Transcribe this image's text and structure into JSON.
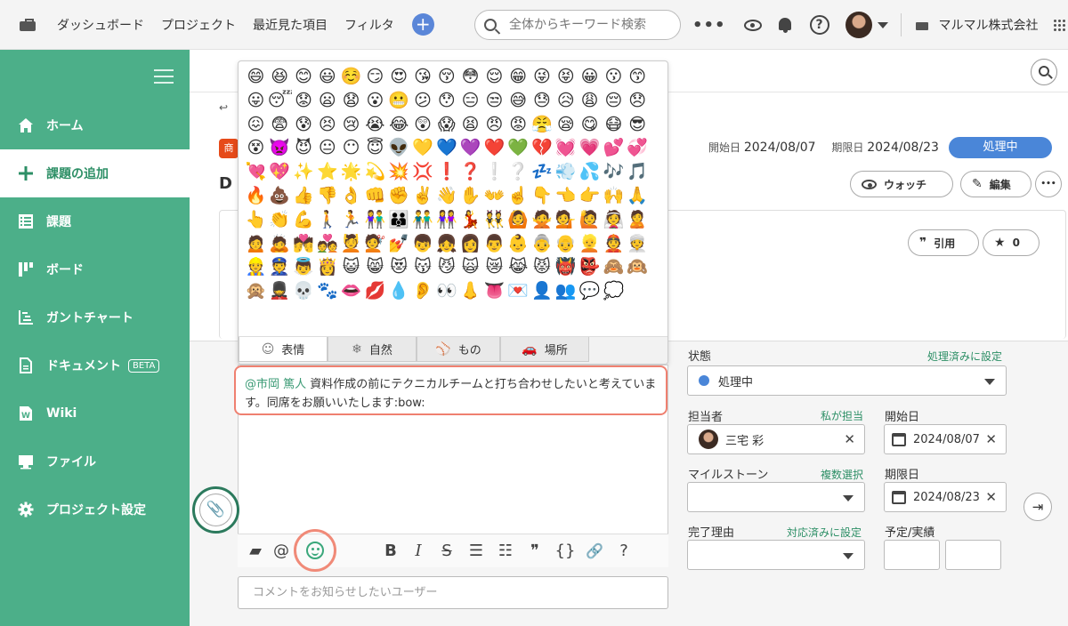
{
  "topbar": {
    "nav": [
      "ダッシュボード",
      "プロジェクト",
      "最近見た項目",
      "フィルタ"
    ],
    "add_label": "+",
    "search_placeholder": "全体からキーワード検索",
    "more_label": "•••",
    "help_label": "?",
    "company": "マルマル株式会社"
  },
  "sidebar": {
    "items": [
      {
        "label": "ホーム",
        "icon": "home-icon"
      },
      {
        "label": "課題の追加",
        "icon": "plus-icon",
        "active": true
      },
      {
        "label": "課題",
        "icon": "list-icon"
      },
      {
        "label": "ボード",
        "icon": "board-icon"
      },
      {
        "label": "ガントチャート",
        "icon": "gantt-icon"
      },
      {
        "label": "ドキュメント",
        "icon": "document-icon",
        "badge": "BETA"
      },
      {
        "label": "Wiki",
        "icon": "wiki-icon"
      },
      {
        "label": "ファイル",
        "icon": "file-icon"
      },
      {
        "label": "プロジェクト設定",
        "icon": "gear-icon"
      }
    ]
  },
  "issue": {
    "title_prefix": "D",
    "tag_char": "商",
    "back_char": "↩",
    "start_label": "開始日",
    "start_date": "2024/08/07",
    "due_label": "期限日",
    "due_date": "2024/08/23",
    "status": "処理中",
    "watch_label": "ウォッチ",
    "edit_label": "編集",
    "more_label": "•••",
    "quote_label": "引用",
    "star_count": "0"
  },
  "emoji_picker": {
    "emojis": [
      "😄",
      "😆",
      "😊",
      "😃",
      "☺️",
      "😏",
      "😍",
      "😘",
      "😚",
      "😳",
      "😌",
      "😁",
      "😜",
      "😝",
      "😀",
      "😗",
      "😙",
      "😛",
      "😴",
      "😟",
      "😦",
      "😧",
      "😮",
      "😬",
      "😕",
      "😯",
      "😑",
      "😒",
      "😅",
      "😓",
      "😥",
      "😩",
      "😔",
      "😞",
      "😖",
      "😨",
      "😰",
      "😣",
      "😢",
      "😭",
      "😂",
      "😲",
      "😱",
      "😫",
      "😠",
      "😡",
      "😤",
      "😪",
      "😋",
      "😷",
      "😎",
      "😵",
      "👿",
      "😈",
      "😐",
      "😶",
      "😇",
      "👽",
      "💛",
      "💙",
      "💜",
      "❤️",
      "💚",
      "💔",
      "💓",
      "💗",
      "💕",
      "💞",
      "💘",
      "💖",
      "✨",
      "⭐",
      "🌟",
      "💫",
      "💥",
      "💢",
      "❗",
      "❓",
      "❕",
      "❔",
      "💤",
      "💨",
      "💦",
      "🎶",
      "🎵",
      "🔥",
      "💩",
      "👍",
      "👎",
      "👌",
      "👊",
      "✊",
      "✌️",
      "👋",
      "✋",
      "👐",
      "☝️",
      "👇",
      "👈",
      "👉",
      "🙌",
      "🙏",
      "👆",
      "👏",
      "💪",
      "🚶",
      "🏃",
      "👫",
      "👪",
      "👬",
      "👭",
      "💃",
      "👯",
      "🙆",
      "🙅",
      "💁",
      "🙋",
      "👰",
      "🙎",
      "🙍",
      "🙇",
      "💏",
      "💑",
      "💆",
      "💇",
      "💅",
      "👦",
      "👧",
      "👩",
      "👨",
      "👶",
      "👵",
      "👴",
      "👱",
      "👲",
      "👳",
      "👷",
      "👮",
      "👼",
      "👸",
      "😺",
      "😸",
      "😻",
      "😽",
      "😼",
      "🙀",
      "😿",
      "😹",
      "😾",
      "👹",
      "👺",
      "🙈",
      "🙉",
      "🙊",
      "💂",
      "💀",
      "🐾",
      "👄",
      "💋",
      "💧",
      "👂",
      "👀",
      "👃",
      "👅",
      "💌",
      "👤",
      "👥",
      "💬",
      "💭"
    ],
    "tabs": [
      {
        "label": "表情",
        "glyph": "☺",
        "icon": "smile-icon"
      },
      {
        "label": "自然",
        "glyph": "❄",
        "icon": "snowflake-icon"
      },
      {
        "label": "もの",
        "glyph": "⚾",
        "icon": "ball-icon"
      },
      {
        "label": "場所",
        "glyph": "🚗",
        "icon": "car-icon"
      }
    ]
  },
  "comment": {
    "mention": "@市岡 篤人",
    "text": " 資料作成の前にテクニカルチームと打ち合わせしたいと考えています。同席をお願いいたします:bow:",
    "notify_placeholder": "コメントをお知らせしたいユーザー"
  },
  "toolbar": {
    "mention_label": "@",
    "bold": "B",
    "italic": "I",
    "strike": "S",
    "bullet": "☰",
    "numbered": "☷",
    "quote": "❞",
    "code": "{}",
    "link": "🔗",
    "help": "?"
  },
  "form": {
    "status_label": "状態",
    "status_link": "処理済みに設定",
    "status_value": "処理中",
    "assignee_label": "担当者",
    "assignee_link": "私が担当",
    "assignee_value": "三宅 彩",
    "start_label": "開始日",
    "start_value": "2024/08/07",
    "milestone_label": "マイルストーン",
    "milestone_link": "複数選択",
    "due_label": "期限日",
    "due_value": "2024/08/23",
    "resolution_label": "完了理由",
    "resolution_link": "対応済みに設定",
    "estimate_label": "予定/実績"
  },
  "colors": {
    "sidebar": "#4caf89",
    "status_blue": "#4a86d8",
    "highlight": "#ef8070",
    "link_green": "#2d8f66"
  }
}
